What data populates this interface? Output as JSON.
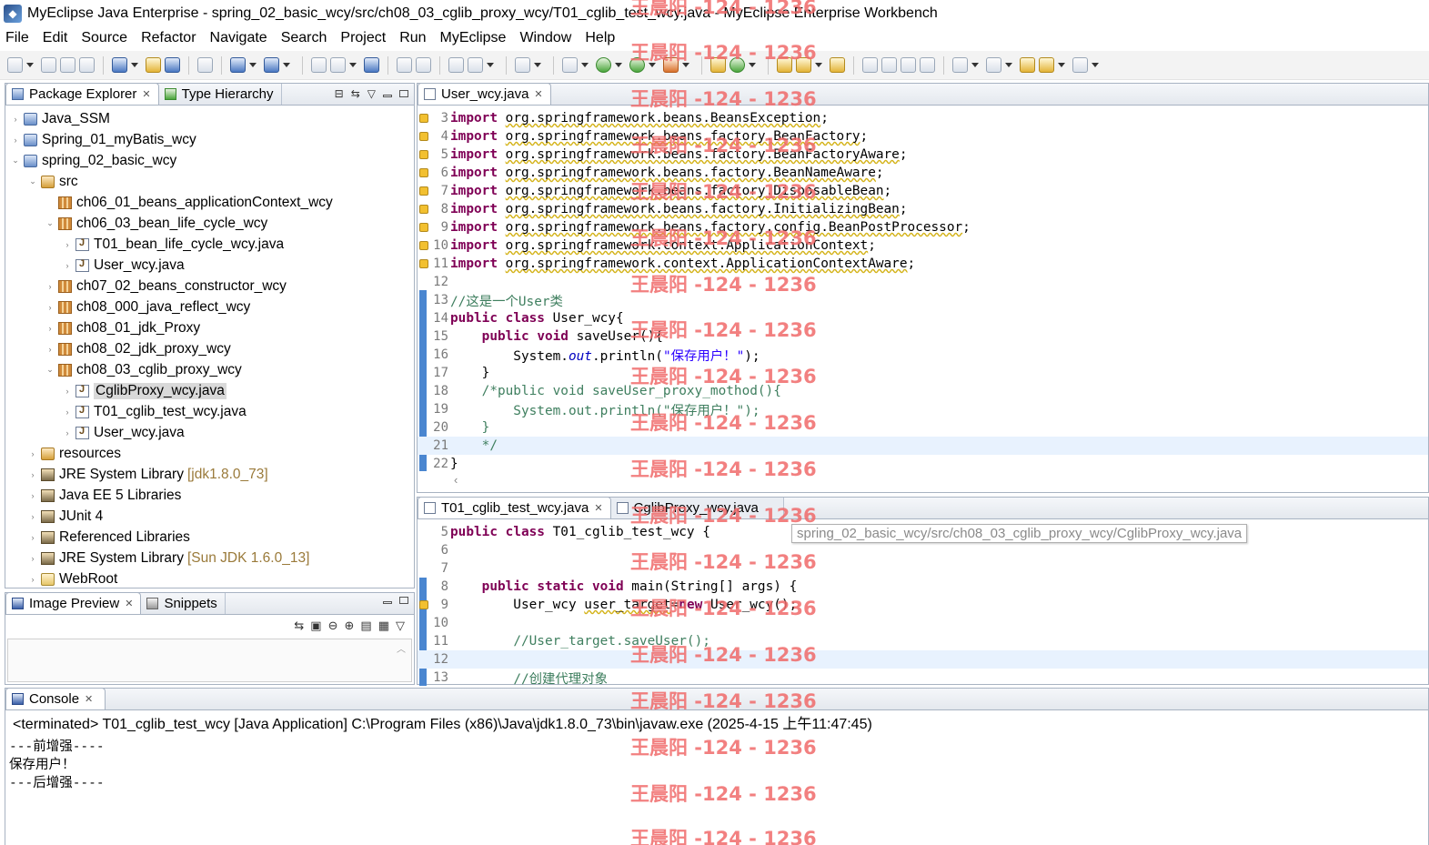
{
  "window": {
    "title": "MyEclipse Java Enterprise - spring_02_basic_wcy/src/ch08_03_cglib_proxy_wcy/T01_cglib_test_wcy.java - MyEclipse Enterprise Workbench"
  },
  "menu": [
    "File",
    "Edit",
    "Source",
    "Refactor",
    "Navigate",
    "Search",
    "Project",
    "Run",
    "MyEclipse",
    "Window",
    "Help"
  ],
  "explorer": {
    "tabs": {
      "package_explorer": "Package Explorer",
      "type_hierarchy": "Type Hierarchy"
    },
    "tree": [
      {
        "label": "Java_SSM",
        "icon": "project-icon",
        "twisty": "›",
        "indent": 0
      },
      {
        "label": "Spring_01_myBatis_wcy",
        "icon": "project-icon",
        "twisty": "›",
        "indent": 0
      },
      {
        "label": "spring_02_basic_wcy",
        "icon": "project-icon",
        "twisty": "⌄",
        "indent": 0
      },
      {
        "label": "src",
        "icon": "source-folder-icon",
        "twisty": "⌄",
        "indent": 1
      },
      {
        "label": "ch06_01_beans_applicationContext_wcy",
        "icon": "package-icon",
        "twisty": "",
        "indent": 2
      },
      {
        "label": "ch06_03_bean_life_cycle_wcy",
        "icon": "package-icon",
        "twisty": "⌄",
        "indent": 2
      },
      {
        "label": "T01_bean_life_cycle_wcy.java",
        "icon": "java-file-icon",
        "twisty": "›",
        "indent": 3
      },
      {
        "label": "User_wcy.java",
        "icon": "java-file-icon",
        "twisty": "›",
        "indent": 3
      },
      {
        "label": "ch07_02_beans_constructor_wcy",
        "icon": "package-icon",
        "twisty": "›",
        "indent": 2
      },
      {
        "label": "ch08_000_java_reflect_wcy",
        "icon": "package-icon",
        "twisty": "›",
        "indent": 2
      },
      {
        "label": "ch08_01_jdk_Proxy",
        "icon": "package-icon",
        "twisty": "›",
        "indent": 2
      },
      {
        "label": "ch08_02_jdk_proxy_wcy",
        "icon": "package-icon",
        "twisty": "›",
        "indent": 2
      },
      {
        "label": "ch08_03_cglib_proxy_wcy",
        "icon": "package-icon",
        "twisty": "⌄",
        "indent": 2
      },
      {
        "label": "CglibProxy_wcy.java",
        "icon": "java-file-icon",
        "twisty": "›",
        "indent": 3,
        "selected": true
      },
      {
        "label": "T01_cglib_test_wcy.java",
        "icon": "java-file-icon",
        "twisty": "›",
        "indent": 3
      },
      {
        "label": "User_wcy.java",
        "icon": "java-file-icon",
        "twisty": "›",
        "indent": 3
      },
      {
        "label": "resources",
        "icon": "source-folder-icon",
        "twisty": "›",
        "indent": 1
      },
      {
        "label": "JRE System Library",
        "suffix": "[jdk1.8.0_73]",
        "icon": "library-icon",
        "twisty": "›",
        "indent": 1
      },
      {
        "label": "Java EE 5 Libraries",
        "icon": "library-icon",
        "twisty": "›",
        "indent": 1
      },
      {
        "label": "JUnit 4",
        "icon": "library-icon",
        "twisty": "›",
        "indent": 1
      },
      {
        "label": "Referenced Libraries",
        "icon": "library-icon",
        "twisty": "›",
        "indent": 1
      },
      {
        "label": "JRE System Library",
        "suffix": "[Sun JDK 1.6.0_13]",
        "icon": "library-icon",
        "twisty": "›",
        "indent": 1
      },
      {
        "label": "WebRoot",
        "icon": "folder-icon",
        "twisty": "›",
        "indent": 1
      }
    ]
  },
  "image_preview": {
    "tabs": {
      "image_preview": "Image Preview",
      "snippets": "Snippets"
    }
  },
  "editor_top": {
    "tab": "User_wcy.java",
    "lines": [
      {
        "n": "3",
        "warn": true,
        "code": "<span class=\"kw\">import</span> <span class=\"wavy\">org.springframework.beans.BeansException</span>;"
      },
      {
        "n": "4",
        "warn": true,
        "code": "<span class=\"kw\">import</span> <span class=\"wavy\">org.springframework.beans.factory.BeanFactory</span>;"
      },
      {
        "n": "5",
        "warn": true,
        "code": "<span class=\"kw\">import</span> <span class=\"wavy\">org.springframework.beans.factory.BeanFactoryAware</span>;"
      },
      {
        "n": "6",
        "warn": true,
        "code": "<span class=\"kw\">import</span> <span class=\"wavy\">org.springframework.beans.factory.BeanNameAware</span>;"
      },
      {
        "n": "7",
        "warn": true,
        "code": "<span class=\"kw\">import</span> <span class=\"wavy\">org.springframework.beans.factory.DisposableBean</span>;"
      },
      {
        "n": "8",
        "warn": true,
        "code": "<span class=\"kw\">import</span> <span class=\"wavy\">org.springframework.beans.factory.InitializingBean</span>;"
      },
      {
        "n": "9",
        "warn": true,
        "code": "<span class=\"kw\">import</span> <span class=\"wavy\">org.springframework.beans.factory.config.BeanPostProcessor</span>;"
      },
      {
        "n": "10",
        "warn": true,
        "code": "<span class=\"kw\">import</span> <span class=\"wavy\">org.springframework.context.ApplicationContext</span>;"
      },
      {
        "n": "11",
        "warn": true,
        "code": "<span class=\"kw\">import</span> <span class=\"wavy\">org.springframework.context.ApplicationContextAware</span>;"
      },
      {
        "n": "12",
        "code": ""
      },
      {
        "n": "13",
        "code": "<span class=\"cm\">//这是一个User类</span>"
      },
      {
        "n": "14",
        "code": "<span class=\"kw\">public</span> <span class=\"kw\">class</span> User_wcy{"
      },
      {
        "n": "15",
        "code": "    <span class=\"kw\">public</span> <span class=\"kw\">void</span> saveUser(){"
      },
      {
        "n": "16",
        "code": "        System.<span class=\"fld\">out</span>.println(<span class=\"str\">\"保存用户！\"</span>);"
      },
      {
        "n": "17",
        "code": "    }"
      },
      {
        "n": "18",
        "code": "    <span class=\"cm\">/*public void saveUser_proxy_mothod(){</span>"
      },
      {
        "n": "19",
        "code": "<span class=\"cm\">        System.out.println(\"保存用户！\");</span>"
      },
      {
        "n": "20",
        "code": "<span class=\"cm\">    }</span>"
      },
      {
        "n": "21",
        "code": "<span class=\"cm\">    */</span>",
        "hl": true
      },
      {
        "n": "22",
        "code": "}"
      }
    ]
  },
  "editor_bottom": {
    "tabs": {
      "t01": "T01_cglib_test_wcy.java",
      "cglib": "CglibProxy_wcy.java"
    },
    "tooltip": "spring_02_basic_wcy/src/ch08_03_cglib_proxy_wcy/CglibProxy_wcy.java",
    "lines": [
      {
        "n": "5",
        "code": "<span class=\"kw\">public</span> <span class=\"kw\">class</span> T01_cglib_test_wcy {"
      },
      {
        "n": "6",
        "code": ""
      },
      {
        "n": "7",
        "code": ""
      },
      {
        "n": "8",
        "code": "    <span class=\"kw\">public</span> <span class=\"kw\">static</span> <span class=\"kw\">void</span> main(String[] args) {"
      },
      {
        "n": "9",
        "warn": true,
        "code": "        User_wcy <span class=\"wavy\">user_target</span>=<span class=\"kw\">new</span> User_wcy();"
      },
      {
        "n": "10",
        "code": ""
      },
      {
        "n": "11",
        "code": "        <span class=\"cm\">//User_target.saveUser();</span>"
      },
      {
        "n": "12",
        "code": "",
        "hl": true
      },
      {
        "n": "13",
        "code": "        <span class=\"cm\">//创建代理对象</span>"
      }
    ]
  },
  "console": {
    "tab": "Console",
    "header": "<terminated> T01_cglib_test_wcy [Java Application] C:\\Program Files (x86)\\Java\\jdk1.8.0_73\\bin\\javaw.exe (2025-4-15 上午11:47:45)",
    "output": [
      "---前增强----",
      "保存用户！",
      "---后增强----"
    ]
  },
  "watermark": {
    "text": "王晨阳 -124 - 1236"
  }
}
